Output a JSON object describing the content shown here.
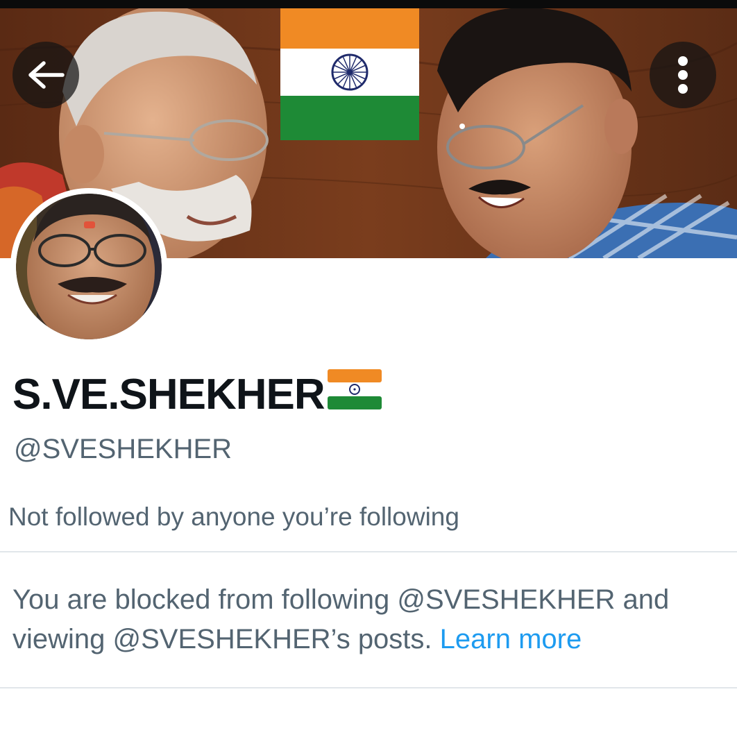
{
  "header": {
    "back_icon": "arrow-left-icon",
    "more_icon": "vertical-dots-icon"
  },
  "banner": {
    "description_icon": "profile-banner-photo",
    "flag_colors": [
      "#f08a24",
      "#ffffff",
      "#1e8a36"
    ],
    "chakra_color": "#1f2a6b"
  },
  "profile": {
    "display_name": "S.VE.SHEKHER",
    "name_emoji": "flag-india-icon",
    "handle": "@SVESHEKHER",
    "followers_note": "Not followed by anyone you’re following"
  },
  "blocked_notice": {
    "text": "You are blocked from following @SVESHEKHER and viewing @SVESHEKHER’s posts.",
    "link_label": "Learn more",
    "link_color": "#1d9bf0"
  },
  "colors": {
    "primary_text": "#0f1419",
    "secondary_text": "#536471",
    "accent": "#1d9bf0",
    "divider": "#e1e6ea"
  }
}
